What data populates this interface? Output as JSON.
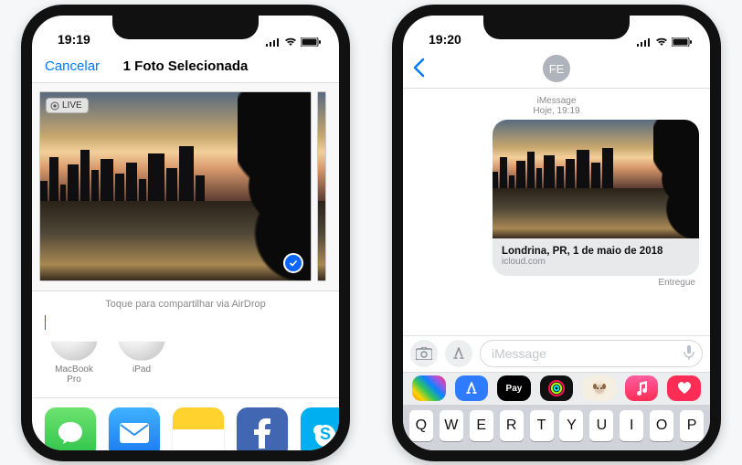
{
  "left": {
    "status_time": "19:19",
    "cancel": "Cancelar",
    "title": "1 Foto Selecionada",
    "live_badge": "LIVE",
    "airdrop_hint": "Toque para compartilhar via AirDrop",
    "airdrop_targets": [
      "MacBook Pro",
      "iPad"
    ],
    "actions": [
      "Mensagens",
      "Mail",
      "Notas",
      "Facebook",
      "Skype"
    ]
  },
  "right": {
    "status_time": "19:20",
    "contact_initials": "FE",
    "thread_label": "iMessage",
    "thread_time": "Hoje, 19:19",
    "link_title": "Londrina, PR, 1 de maio de 2018",
    "link_subtitle": "icloud.com",
    "delivered": "Entregue",
    "compose_placeholder": "iMessage",
    "app_pay": "Pay",
    "keys": [
      "Q",
      "W",
      "E",
      "R",
      "T",
      "Y",
      "U",
      "I",
      "O",
      "P"
    ]
  }
}
